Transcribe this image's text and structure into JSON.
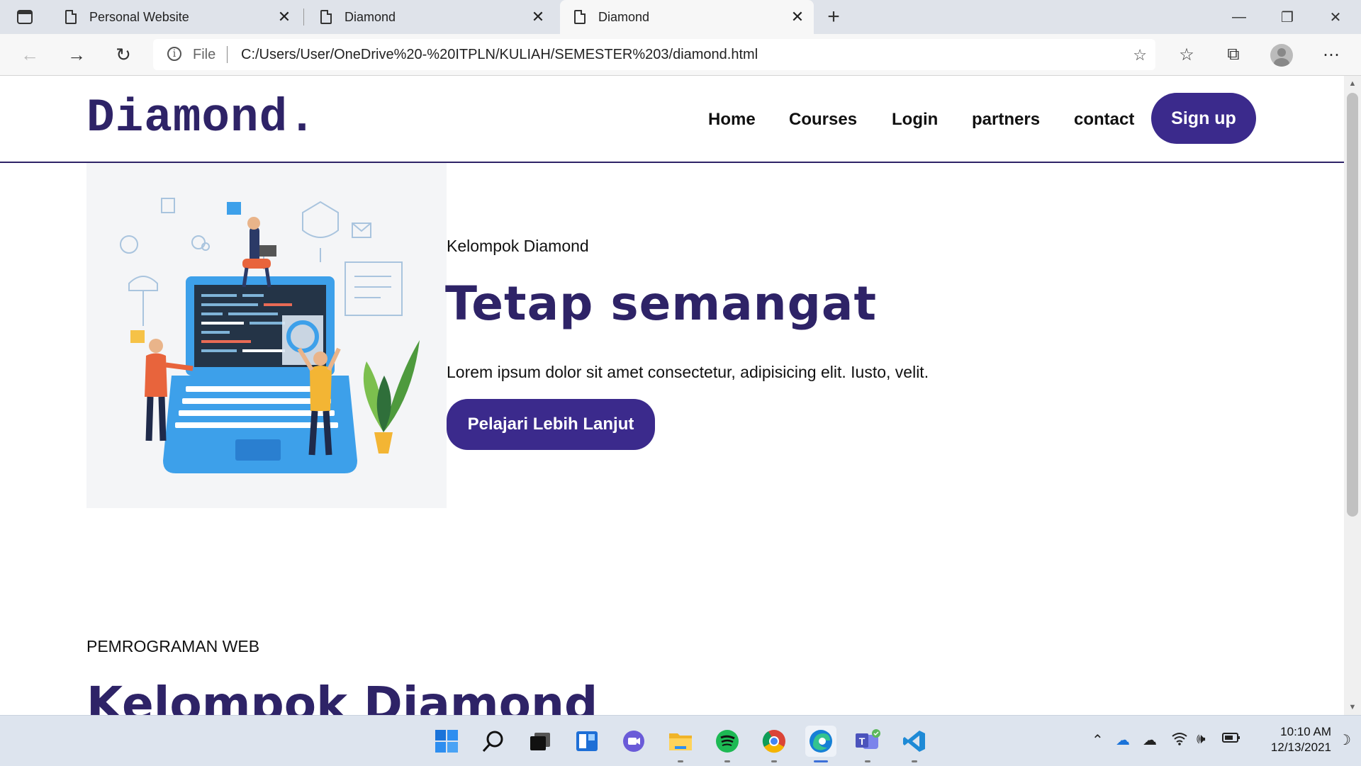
{
  "browser": {
    "tabs": [
      {
        "title": "Personal Website",
        "active": false
      },
      {
        "title": "Diamond",
        "active": false
      },
      {
        "title": "Diamond",
        "active": true
      }
    ],
    "new_tab_glyph": "+",
    "address": {
      "scheme_label": "File",
      "url": "C:/Users/User/OneDrive%20-%20ITPLN/KULIAH/SEMESTER%203/diamond.html"
    }
  },
  "site": {
    "logo": "Diamond.",
    "nav": [
      "Home",
      "Courses",
      "Login",
      "partners",
      "contact"
    ],
    "signup_label": "Sign up",
    "hero": {
      "subtitle": "Kelompok Diamond",
      "title": "Tetap semangat",
      "text": "Lorem ipsum dolor sit amet consectetur, adipisicing elit. Iusto, velit.",
      "button_label": "Pelajari Lebih Lanjut"
    },
    "section": {
      "subtitle": "PEMROGRAMAN WEB",
      "title": "Kelompok Diamond"
    }
  },
  "colors": {
    "brand": "#2e2367",
    "button": "#3b2a8c"
  },
  "taskbar": {
    "apps": [
      "start-icon",
      "search-icon",
      "task-view-icon",
      "widgets-icon",
      "chat-icon",
      "file-explorer-icon",
      "spotify-icon",
      "chrome-icon",
      "edge-icon",
      "teams-icon",
      "vscode-icon"
    ],
    "tray": [
      "chevron-up-icon",
      "onedrive-icon",
      "onedrive-personal-icon",
      "wifi-icon",
      "volume-icon",
      "battery-icon"
    ],
    "time": "10:10 AM",
    "date": "12/13/2021"
  }
}
